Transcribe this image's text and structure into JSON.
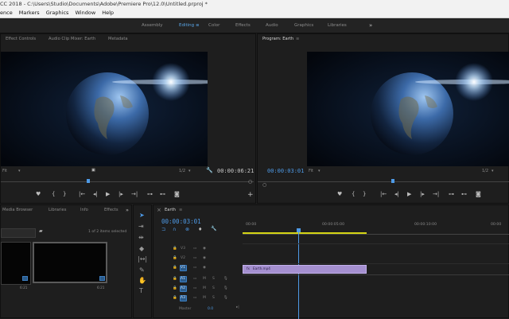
{
  "titlebar": {
    "title": "CC 2018 - C:\\Users\\Studio\\Documents\\Adobe\\Premiere Pro\\12.0\\Untitled.prproj *"
  },
  "menu": {
    "items": [
      "ence",
      "Markers",
      "Graphics",
      "Window",
      "Help"
    ]
  },
  "workspaces": {
    "items": [
      "Assembly",
      "Editing",
      "Color",
      "Effects",
      "Audio",
      "Graphics",
      "Libraries"
    ],
    "active_marker": "≡",
    "more": "»"
  },
  "source_panel": {
    "tabs": [
      "Effect Controls",
      "Audio Clip Mixer: Earth",
      "Metadata"
    ],
    "fit_label": "Fit",
    "resolution": "1/2",
    "timecode": "00:00:06:21",
    "timecode_left": ""
  },
  "program_panel": {
    "title": "Program: Earth",
    "menu_icon": "≡",
    "timecode": "00:00:03:01",
    "fit_label": "Fit",
    "resolution": "1/2"
  },
  "project_panel": {
    "tabs": [
      "Media Browser",
      "Libraries",
      "Info",
      "Effects"
    ],
    "more": "»",
    "items_selected": "1 of 2 items selected",
    "clip1_duration": "6:21",
    "clip2_duration": "6:21"
  },
  "timeline": {
    "close": "×",
    "sequence_name": "Earth",
    "menu_icon": "≡",
    "timecode": "00:00:03:01",
    "ruler": [
      "00:00",
      "00:00:05:00",
      "00:00:10:00",
      "00:00"
    ],
    "video_tracks": [
      "V3",
      "V2",
      "V1"
    ],
    "audio_tracks": [
      "A1",
      "A2",
      "A3"
    ],
    "master_label": "Master",
    "master_value": "0.0",
    "clip_label": "Earth.mp4",
    "track_letters": [
      "M",
      "S"
    ]
  },
  "colors": {
    "accent": "#4e9ae6",
    "clip": "#a590d0",
    "workarea": "#d4d414"
  },
  "icons": [
    "selection-tool-icon",
    "track-select-icon",
    "ripple-edit-icon",
    "razor-icon",
    "slip-icon",
    "pen-icon",
    "hand-icon",
    "type-icon",
    "play-icon",
    "wrench-icon",
    "camera-icon"
  ]
}
